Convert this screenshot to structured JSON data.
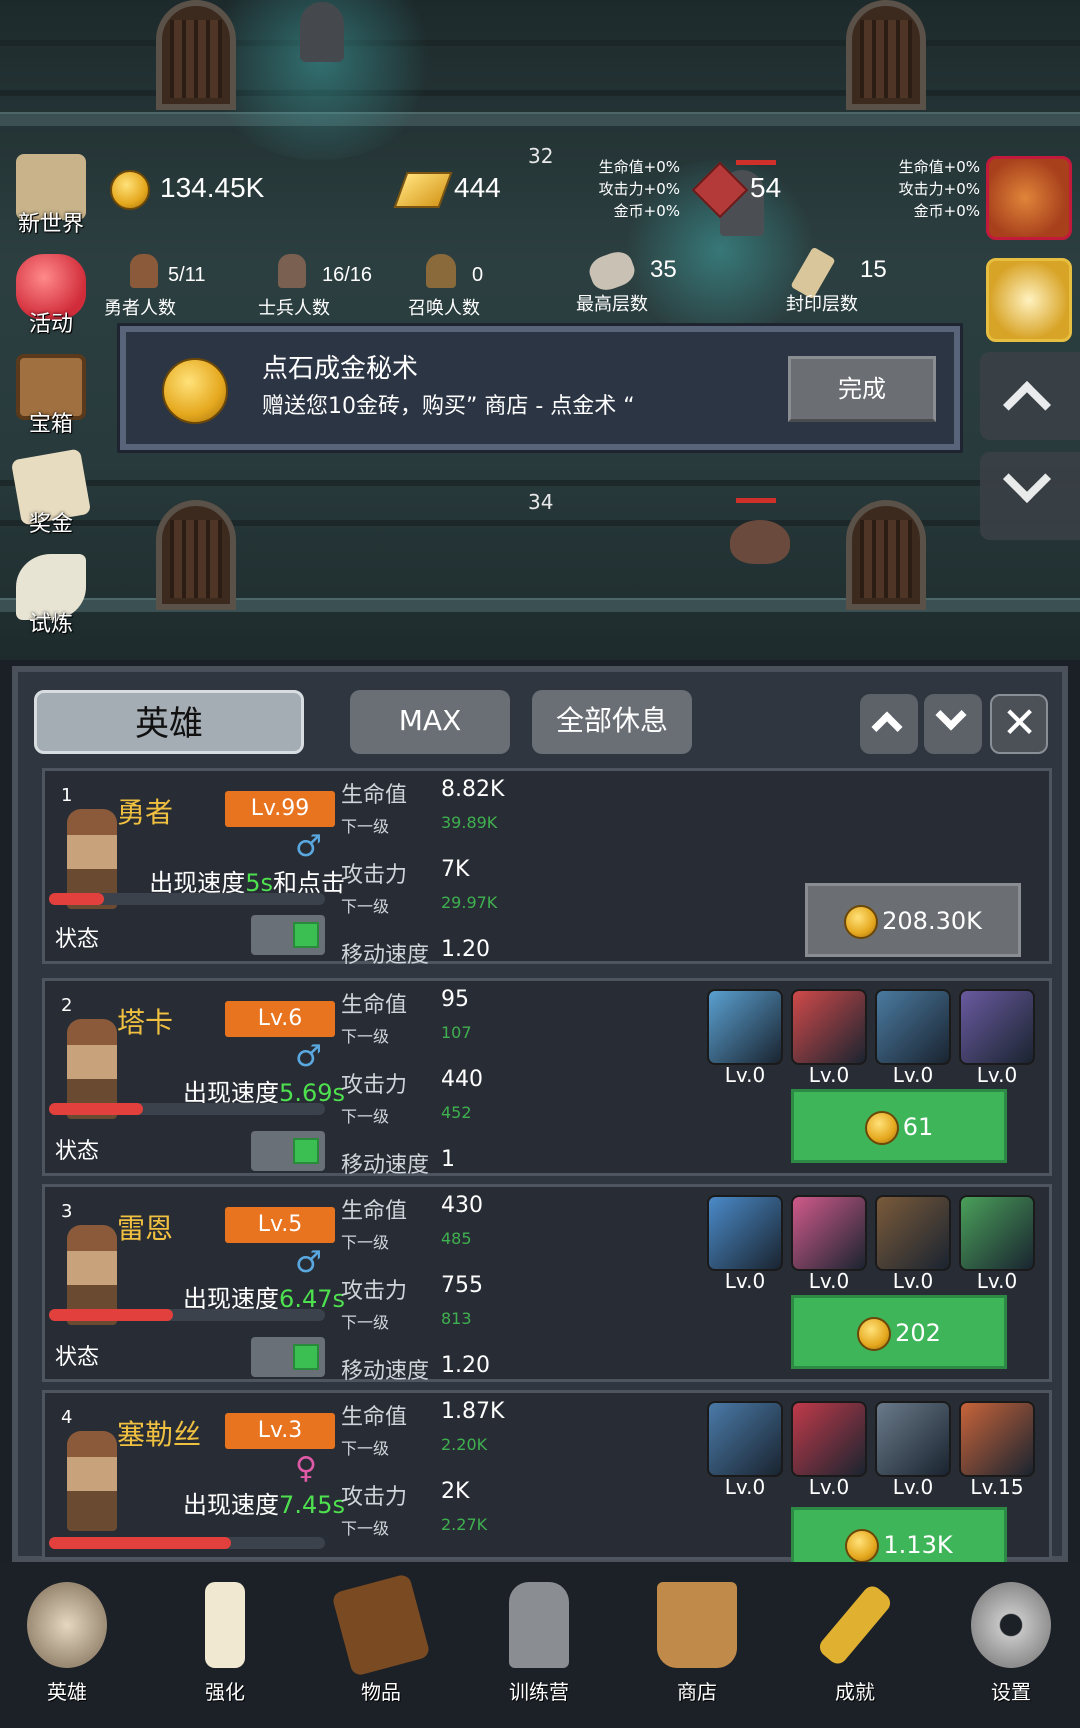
{
  "scene": {
    "floor_numbers": [
      "32",
      "34"
    ],
    "enemy_hp_top": 0.9,
    "enemy_hp_bottom": 0.9
  },
  "resources": {
    "gold": "134.45K",
    "gold_bars": "444",
    "gems": "54",
    "bonus_left": [
      "生命值+0%",
      "攻击力+0%",
      "金币+0%"
    ],
    "bonus_right": [
      "生命值+0%",
      "攻击力+0%",
      "金币+0%"
    ],
    "heroes": {
      "value": "5/11",
      "label": "勇者人数"
    },
    "soldiers": {
      "value": "16/16",
      "label": "士兵人数"
    },
    "summons": {
      "value": "0",
      "label": "召唤人数"
    },
    "max_floor": {
      "value": "35",
      "label": "最高层数"
    },
    "seal_floor": {
      "value": "15",
      "label": "封印层数"
    }
  },
  "side_menu": [
    "新世界",
    "活动",
    "宝箱",
    "奖金",
    "试炼"
  ],
  "popup": {
    "title": "点石成金秘术",
    "desc": "赠送您10金砖，购买” 商店 - 点金术 “",
    "button": "完成"
  },
  "panel": {
    "tab_heroes": "英雄",
    "tab_max": "MAX",
    "tab_rest": "全部休息",
    "status_label": "状态",
    "labels": {
      "hp": "生命值",
      "next": "下一级",
      "atk": "攻击力",
      "move": "移动速度",
      "speed_prefix": "出现速度"
    },
    "heroes": [
      {
        "idx": "1",
        "name": "勇者",
        "level": "Lv.99",
        "gender": "♂",
        "speed": "5s",
        "speed_suffix": "和点击",
        "hp": "8.82K",
        "hp_next": "39.89K",
        "atk": "7K",
        "atk_next": "29.97K",
        "move": "1.20",
        "cost": "208.30K",
        "hpbar": 0.2
      },
      {
        "idx": "2",
        "name": "塔卡",
        "level": "Lv.6",
        "gender": "♂",
        "speed": "5.69s",
        "speed_suffix": "",
        "hp": "95",
        "hp_next": "107",
        "atk": "440",
        "atk_next": "452",
        "move": "1",
        "cost": "61",
        "hpbar": 0.34,
        "skills": [
          "Lv.0",
          "Lv.0",
          "Lv.0",
          "Lv.0"
        ]
      },
      {
        "idx": "3",
        "name": "雷恩",
        "level": "Lv.5",
        "gender": "♂",
        "speed": "6.47s",
        "speed_suffix": "",
        "hp": "430",
        "hp_next": "485",
        "atk": "755",
        "atk_next": "813",
        "move": "1.20",
        "cost": "202",
        "hpbar": 0.45,
        "skills": [
          "Lv.0",
          "Lv.0",
          "Lv.0",
          "Lv.0"
        ]
      },
      {
        "idx": "4",
        "name": "塞勒丝",
        "level": "Lv.3",
        "gender": "♀",
        "speed": "7.45s",
        "speed_suffix": "",
        "hp": "1.87K",
        "hp_next": "2.20K",
        "atk": "2K",
        "atk_next": "2.27K",
        "move": "",
        "cost": "1.13K",
        "hpbar": 0.66,
        "skills": [
          "Lv.0",
          "Lv.0",
          "Lv.0",
          "Lv.15"
        ]
      }
    ]
  },
  "nav": [
    "英雄",
    "强化",
    "物品",
    "训练营",
    "商店",
    "成就",
    "设置"
  ],
  "colors": {
    "gold": "#f0c040",
    "level_badge": "#e8741f",
    "upgrade_green": "#3fb55a",
    "speed_green": "#4ee04e",
    "next_green": "#3fb04f"
  }
}
